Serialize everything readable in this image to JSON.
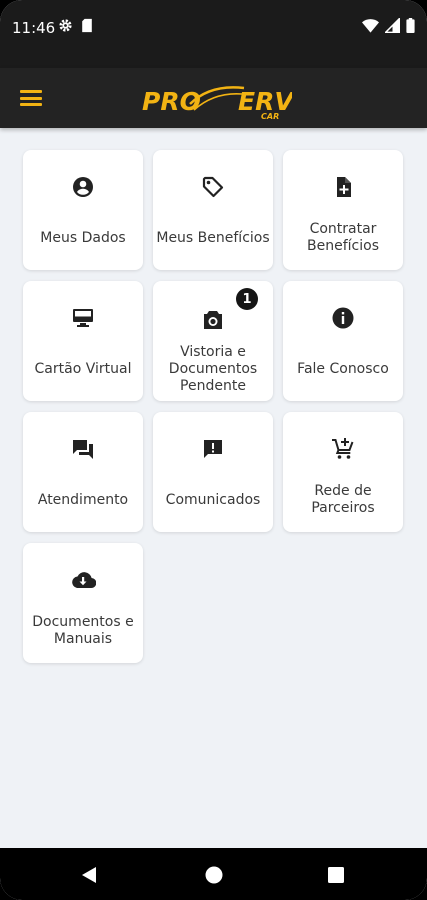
{
  "status_bar": {
    "time": "11:46"
  },
  "app_bar": {
    "logo": {
      "part1": "PRO",
      "part2": "ERV",
      "sub": "CAR"
    }
  },
  "menu": [
    {
      "label": "Meus Dados",
      "icon": "account-circle-icon"
    },
    {
      "label": "Meus Benefícios",
      "icon": "tag-icon"
    },
    {
      "label": "Contratar Benefícios",
      "icon": "note-add-icon"
    },
    {
      "label": "Cartão Virtual",
      "icon": "monitor-icon"
    },
    {
      "label": "Vistoria e Documentos Pendente",
      "icon": "camera-icon",
      "badge": "1"
    },
    {
      "label": "Fale Conosco",
      "icon": "info-icon"
    },
    {
      "label": "Atendimento",
      "icon": "chat-icon"
    },
    {
      "label": "Comunicados",
      "icon": "announcement-icon"
    },
    {
      "label": "Rede de Parceiros",
      "icon": "add-cart-icon"
    },
    {
      "label": "Documentos e Manuais",
      "icon": "cloud-download-icon"
    }
  ],
  "colors": {
    "accent": "#f2b313",
    "app_bar": "#232323",
    "background": "#eff2f6"
  }
}
